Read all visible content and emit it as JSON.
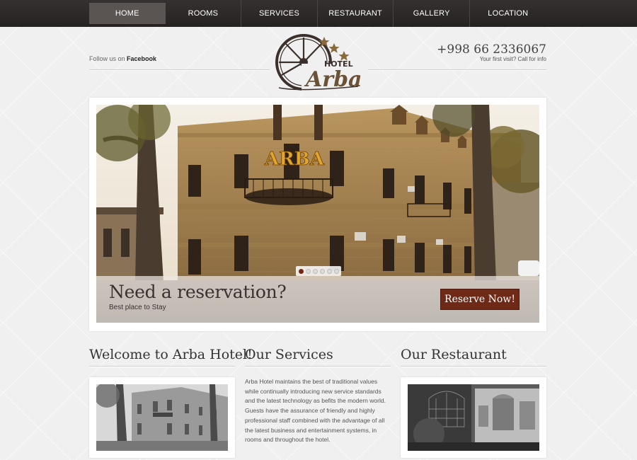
{
  "nav": {
    "items": [
      {
        "label": "HOME",
        "active": true
      },
      {
        "label": "ROOMS",
        "active": false
      },
      {
        "label": "SERVICES",
        "active": false
      },
      {
        "label": "RESTAURANT",
        "active": false
      },
      {
        "label": "GALLERY",
        "active": false
      },
      {
        "label": "LOCATION",
        "active": false
      }
    ]
  },
  "header": {
    "follow_prefix": "Follow us on ",
    "follow_link": "Facebook",
    "phone": "+998 66 2336067",
    "phone_sub": "Your first visit? Call for info",
    "logo_small": "HOTEL",
    "logo_main": "Arba"
  },
  "slider": {
    "sign_text": "ARBA",
    "caption_title": "Need a reservation?",
    "caption_sub": "Best place to Stay",
    "reserve_label": "Reserve Now!",
    "dot_count": 6,
    "active_dot": 1
  },
  "sections": {
    "welcome_title": "Welcome to Arba Hotel!",
    "services_title": "Our Services",
    "services_text": "Arba Hotel maintains the best of traditional values while continually introducing new service standards and the latest technology as befits the modern world. Guests have the assurance of friendly and highly professional staff combined with the advantage of all the latest business and entertainment systems, in rooms and throughout the hotel.",
    "restaurant_title": "Our Restaurant"
  },
  "colors": {
    "nav_bg": "#2e2a29",
    "nav_active": "#5a5453",
    "accent": "#6e2a16"
  }
}
